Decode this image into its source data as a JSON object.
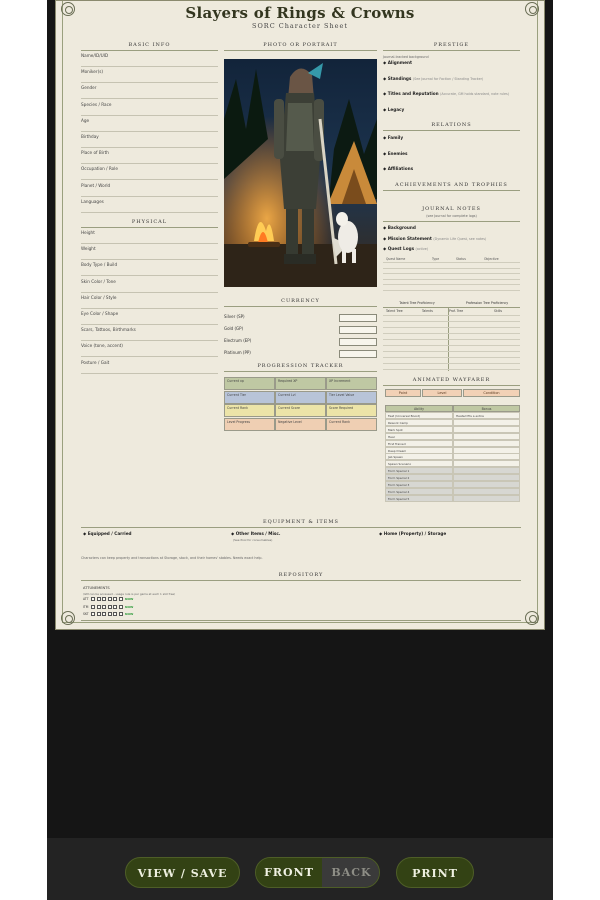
{
  "sheet": {
    "title": "Slayers of Rings & Crowns",
    "subtitle": "SORC Character Sheet"
  },
  "basic_info": {
    "heading": "Basic Info",
    "fields": [
      "Name/ID/UID",
      "Moniker(s)",
      "Gender",
      "Species / Race",
      "Age",
      "Birthday",
      "Place of Birth",
      "Occupation / Role",
      "Planet / World",
      "Languages"
    ]
  },
  "physical": {
    "heading": "Physical",
    "fields": [
      "Height",
      "Weight",
      "Body Type / Build",
      "Skin Color / Tone",
      "Hair Color / Style",
      "Eye Color / Shape",
      "Scars, Tattoos, Birthmarks",
      "Voice (tone, accent)",
      "Posture / Gait"
    ]
  },
  "portrait": {
    "heading": "Photo or Portrait"
  },
  "currency": {
    "heading": "Currency",
    "rows": [
      "Silver (SP)",
      "Gold (GP)",
      "Electrum (EP)",
      "Platinum (PP)"
    ]
  },
  "progression": {
    "heading": "Progression Tracker",
    "rows": [
      [
        "Current xp",
        "Required XP",
        "XP Increment"
      ],
      [
        "Current Tier",
        "Current Lvl",
        "Tier Level Value"
      ],
      [
        "Current Rank",
        "Current Score",
        "Score Required"
      ],
      [
        "Level Progress",
        "Negative Level",
        "Current Rank"
      ]
    ]
  },
  "prestige": {
    "heading": "Prestige",
    "note": "Journal-tracked background",
    "items": [
      {
        "label": "Alignment",
        "note": ""
      },
      {
        "label": "Standings",
        "note": "(See Journal for Faction / Standing Tracker)"
      },
      {
        "label": "Titles and Reputation",
        "note": "(Accurate, GM holds standard, note rules)"
      },
      {
        "label": "Legacy",
        "note": ""
      }
    ]
  },
  "relations": {
    "heading": "Relations",
    "items": [
      "Family",
      "Enemies",
      "Affiliations"
    ]
  },
  "achievements": {
    "heading": "Achievements and Trophies"
  },
  "journal": {
    "heading": "Journal Notes",
    "note": "(see Journal for complete logs)",
    "items": [
      {
        "label": "Background",
        "note": ""
      },
      {
        "label": "Mission Statement",
        "note": "(Dynamic Life Quest, see notes)"
      },
      {
        "label": "Quest Logs",
        "note": "(active)"
      }
    ],
    "quest_columns": [
      "Quest Name",
      "Type",
      "Status",
      "Objective"
    ]
  },
  "talent_tree": {
    "left_heading": "Talent Tree Proficiency",
    "right_heading": "Profession Tree Proficiency",
    "columns": [
      "Talent Tree",
      "Talents",
      "Prof. Tree",
      "Skills"
    ]
  },
  "animated_wayfarer": {
    "heading": "Animated Wayfarer",
    "top_labels": [
      "Point",
      "Level",
      "Condition"
    ],
    "columns": [
      "Ability",
      "Bonus"
    ],
    "abilities": [
      "Feat (Universal Boost)",
      "Rework Camp",
      "Mark Spot",
      "Heal",
      "First Trained",
      "Deep Dream",
      "Jab Spawn",
      "Spawn Scenario",
      "Form Special 1",
      "Form Special 2",
      "Form Special 3",
      "Form Special 4",
      "Form Special 5"
    ],
    "first_bonus": "Heated fits a entire"
  },
  "equipment": {
    "heading": "Equipment & Items",
    "cols": [
      {
        "label": "Equipped / Carried",
        "note": ""
      },
      {
        "label": "Other Items / Misc.",
        "note": "(See Pool for consumables)"
      },
      {
        "label": "Home (Property) / Storage",
        "note": ""
      }
    ],
    "footnote": "Characters can keep property and transactions at Storage, stock, and their homes' stables. Needs exact help."
  },
  "repository": {
    "heading": "Repository",
    "attunements_label": "Attunements",
    "attunements_note": "(GM can be accessed - usage rule is per game at each 1 slot free)",
    "tracks": [
      {
        "label": "ATT",
        "tag": "NOW"
      },
      {
        "label": "ITM",
        "tag": "NOW"
      },
      {
        "label": "SKT",
        "tag": "NOW"
      }
    ]
  },
  "buttons": {
    "view_save": "View / Save",
    "front": "Front",
    "back": "Back",
    "print": "Print"
  },
  "colors": {
    "button_green": "#334214",
    "page_bg": "#eeeadd",
    "frame_dark": "#151515"
  }
}
